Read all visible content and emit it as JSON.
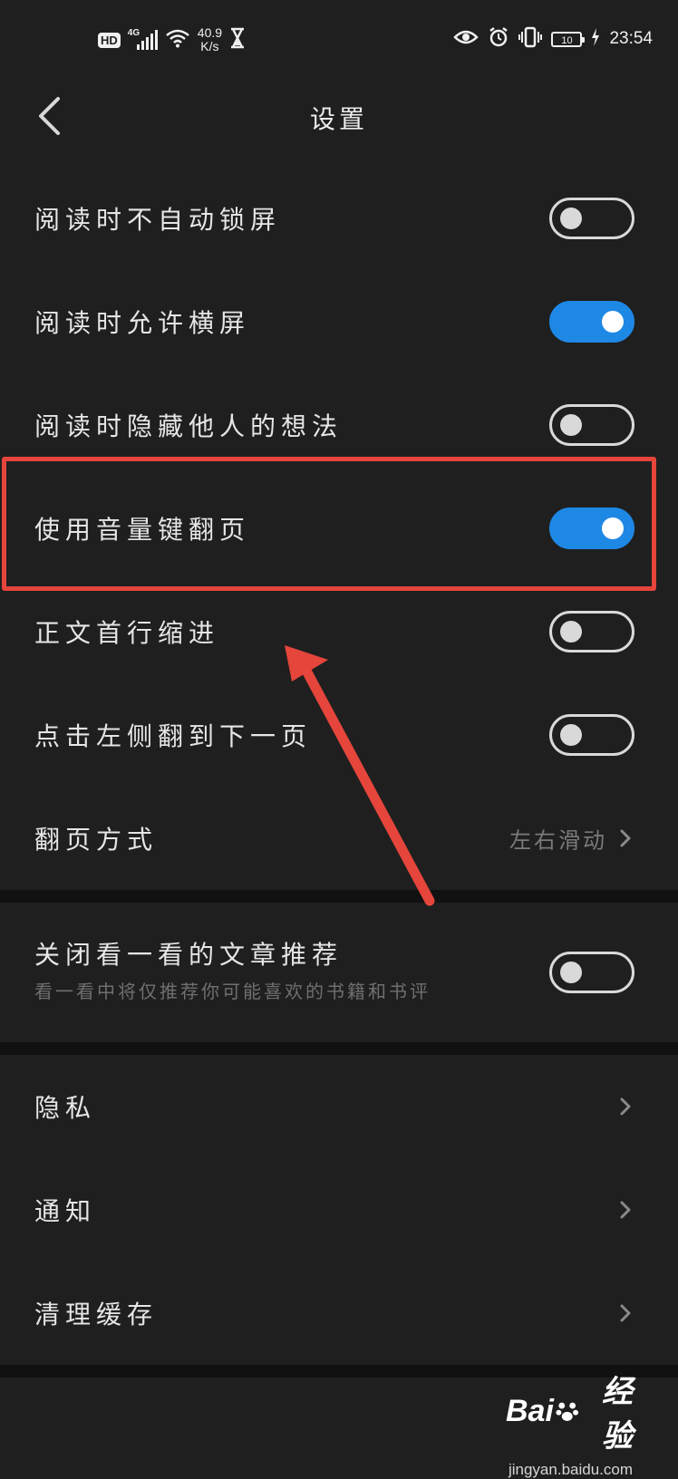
{
  "status_bar": {
    "hd": "HD",
    "network": "4G",
    "speed_value": "40.9",
    "speed_unit": "K/s",
    "battery": "10",
    "time": "23:54"
  },
  "header": {
    "title": "设置"
  },
  "reading_settings": [
    {
      "label": "阅读时不自动锁屏",
      "on": false
    },
    {
      "label": "阅读时允许横屏",
      "on": true
    },
    {
      "label": "阅读时隐藏他人的想法",
      "on": false
    },
    {
      "label": "使用音量键翻页",
      "on": true
    },
    {
      "label": "正文首行缩进",
      "on": false
    },
    {
      "label": "点击左侧翻到下一页",
      "on": false
    }
  ],
  "page_turn": {
    "label": "翻页方式",
    "value": "左右滑动"
  },
  "recommend": {
    "label": "关闭看一看的文章推荐",
    "sub": "看一看中将仅推荐你可能喜欢的书籍和书评",
    "on": false
  },
  "other": [
    {
      "label": "隐私"
    },
    {
      "label": "通知"
    },
    {
      "label": "清理缓存"
    }
  ],
  "watermark": {
    "brand": "Bai",
    "brand_suffix": "经验",
    "url": "jingyan.baidu.com"
  },
  "colors": {
    "background": "#1f1f1f",
    "toggle_on": "#1e88e5",
    "annotation": "#e5453b"
  }
}
